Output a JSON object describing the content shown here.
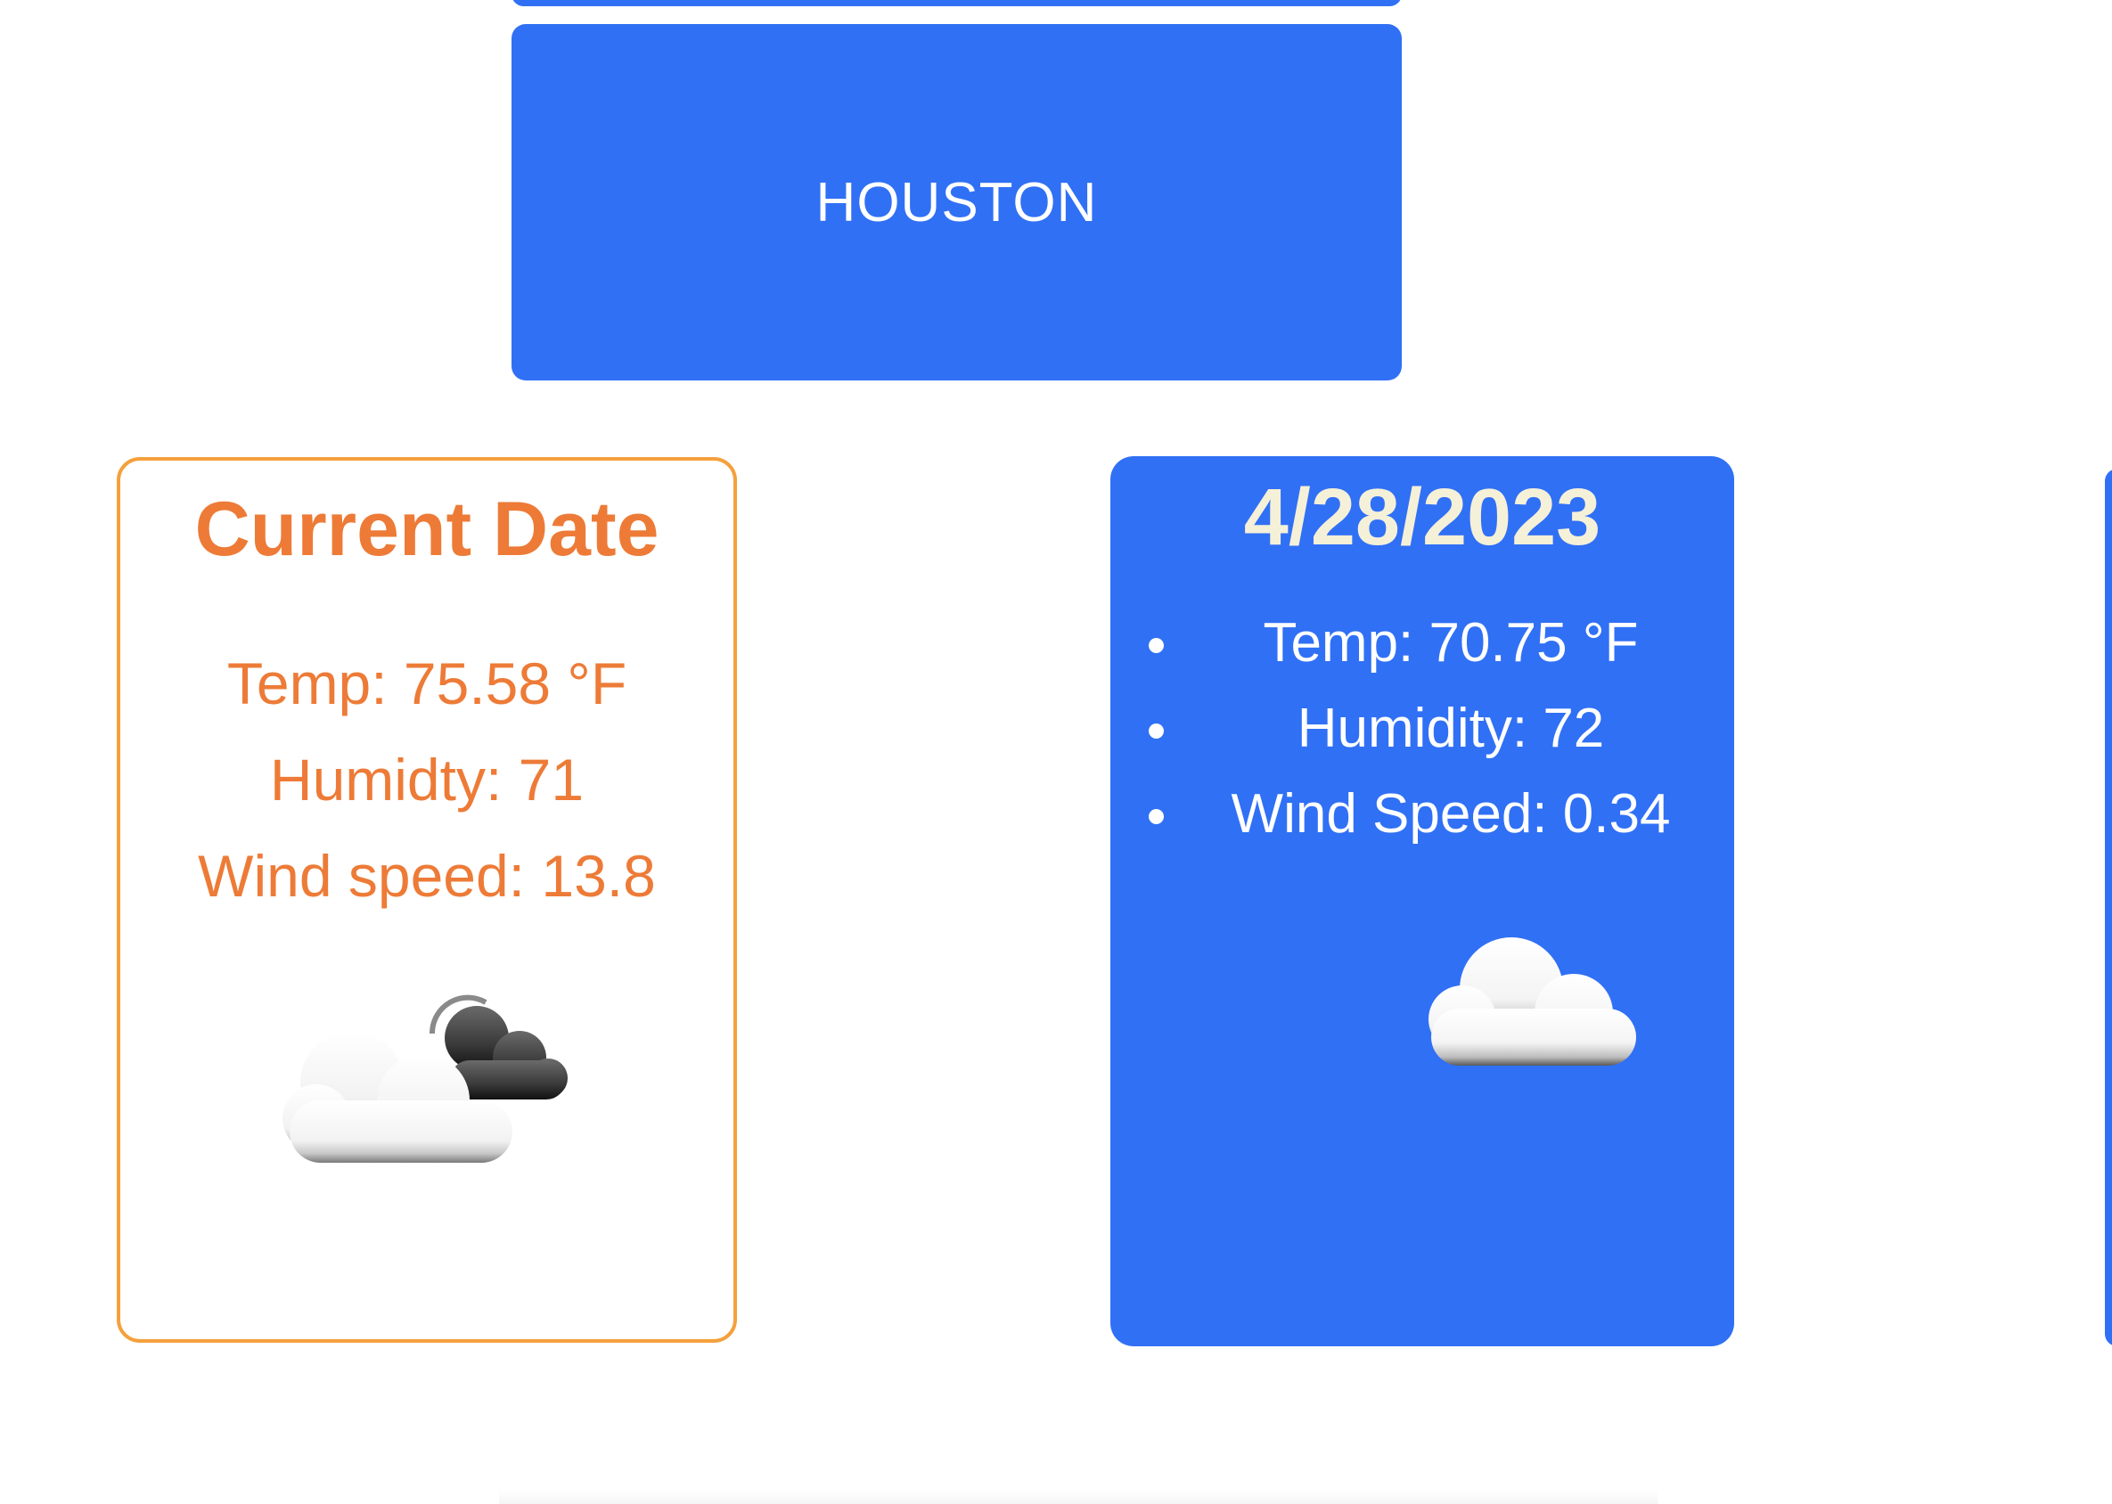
{
  "search": {
    "city_button_label": "HOUSTON"
  },
  "current": {
    "title": "Current Date",
    "temp": "Temp: 75.58 °F",
    "humidity": "Humidty: 71",
    "wind": "Wind speed: 13.8",
    "icon": "cloud-moon-icon"
  },
  "forecast": [
    {
      "date": "4/28/2023",
      "temp": "Temp: 70.75 °F",
      "humidity": "Humidity: 72",
      "wind": "Wind Speed: 0.34",
      "icon": "cloud-icon"
    }
  ],
  "colors": {
    "primary_blue": "#3070F5",
    "current_border": "#F5A03C",
    "current_text": "#ED7B37",
    "forecast_title": "#F5F0D8"
  }
}
